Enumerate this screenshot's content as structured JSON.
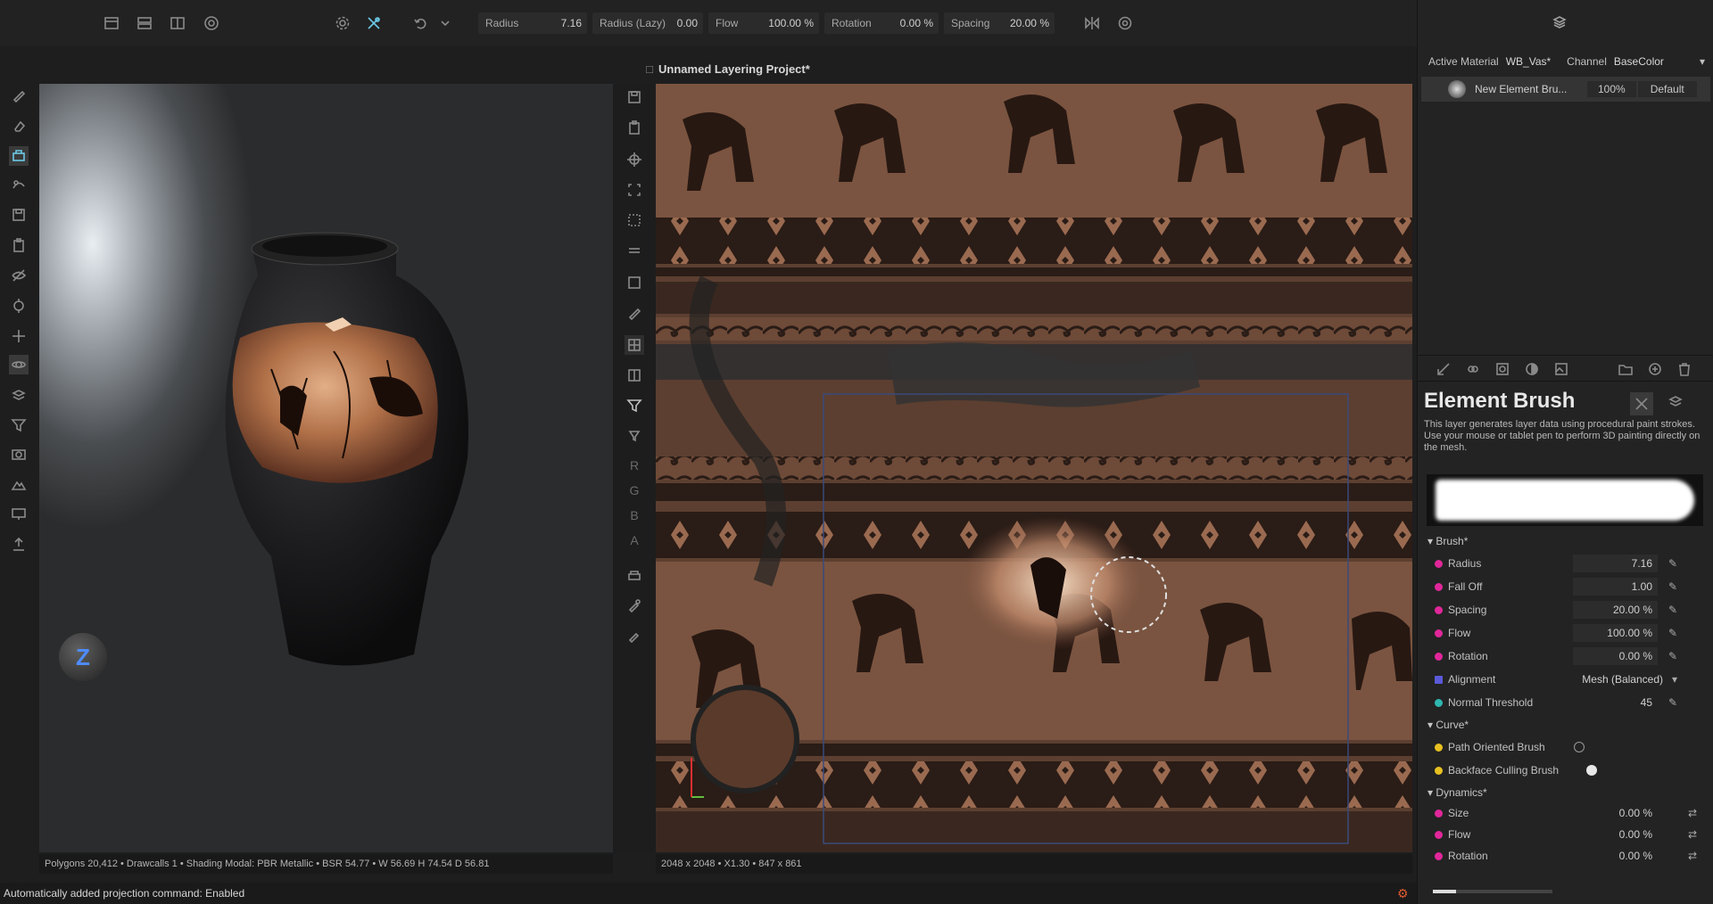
{
  "toolbar": {
    "params": [
      {
        "label": "Radius",
        "value": "7.16"
      },
      {
        "label": "Radius (Lazy)",
        "value": "0.00"
      },
      {
        "label": "Flow",
        "value": "100.00 %"
      },
      {
        "label": "Rotation",
        "value": "0.00 %"
      },
      {
        "label": "Spacing",
        "value": "20.00 %"
      }
    ]
  },
  "project_title": "Unnamed Layering Project*",
  "viewport3d": {
    "status": "Polygons 20,412 • Drawcalls 1 • Shading Modal: PBR Metallic • BSR 54.77 • W 56.69 H 74.54 D 56.81",
    "nav_gizmo_label": "Z"
  },
  "viewport2d": {
    "status": "2048 x 2048 • X1.30 • 847 x 861",
    "channel_letters": [
      "R",
      "G",
      "B",
      "A"
    ]
  },
  "bottom_status": "Automatically added projection command: Enabled",
  "right_panel": {
    "active_material_label": "Active Material",
    "active_material_value": "WB_Vas*",
    "channel_label": "Channel",
    "channel_value": "BaseColor",
    "layer_name": "New Element Bru...",
    "layer_opacity": "100%",
    "layer_blend": "Default",
    "brush_title": "Element Brush",
    "brush_desc": "This layer generates layer data using procedural paint strokes. Use your mouse or tablet pen to perform 3D painting directly on the mesh.",
    "section_brush": "Brush*",
    "brush_props": [
      {
        "label": "Radius",
        "value": "7.16",
        "color": "#e0279a"
      },
      {
        "label": "Fall Off",
        "value": "1.00",
        "color": "#e0279a"
      },
      {
        "label": "Spacing",
        "value": "20.00 %",
        "color": "#e0279a"
      },
      {
        "label": "Flow",
        "value": "100.00 %",
        "color": "#e0279a"
      },
      {
        "label": "Rotation",
        "value": "0.00 %",
        "color": "#e0279a"
      },
      {
        "label": "Alignment",
        "value": "Mesh (Balanced)",
        "color": "#5a5ad8"
      },
      {
        "label": "Normal Threshold",
        "value": "45",
        "color": "#2eb8b0"
      }
    ],
    "section_curve": "Curve*",
    "curve_props": [
      {
        "label": "Path Oriented Brush",
        "color": "#e8c020"
      },
      {
        "label": "Backface Culling Brush",
        "color": "#e8c020"
      }
    ],
    "section_dynamics": "Dynamics*",
    "dynamics_props": [
      {
        "label": "Size",
        "value": "0.00 %",
        "color": "#e0279a"
      },
      {
        "label": "Flow",
        "value": "0.00 %",
        "color": "#e0279a"
      },
      {
        "label": "Rotation",
        "value": "0.00 %",
        "color": "#e0279a"
      }
    ]
  }
}
